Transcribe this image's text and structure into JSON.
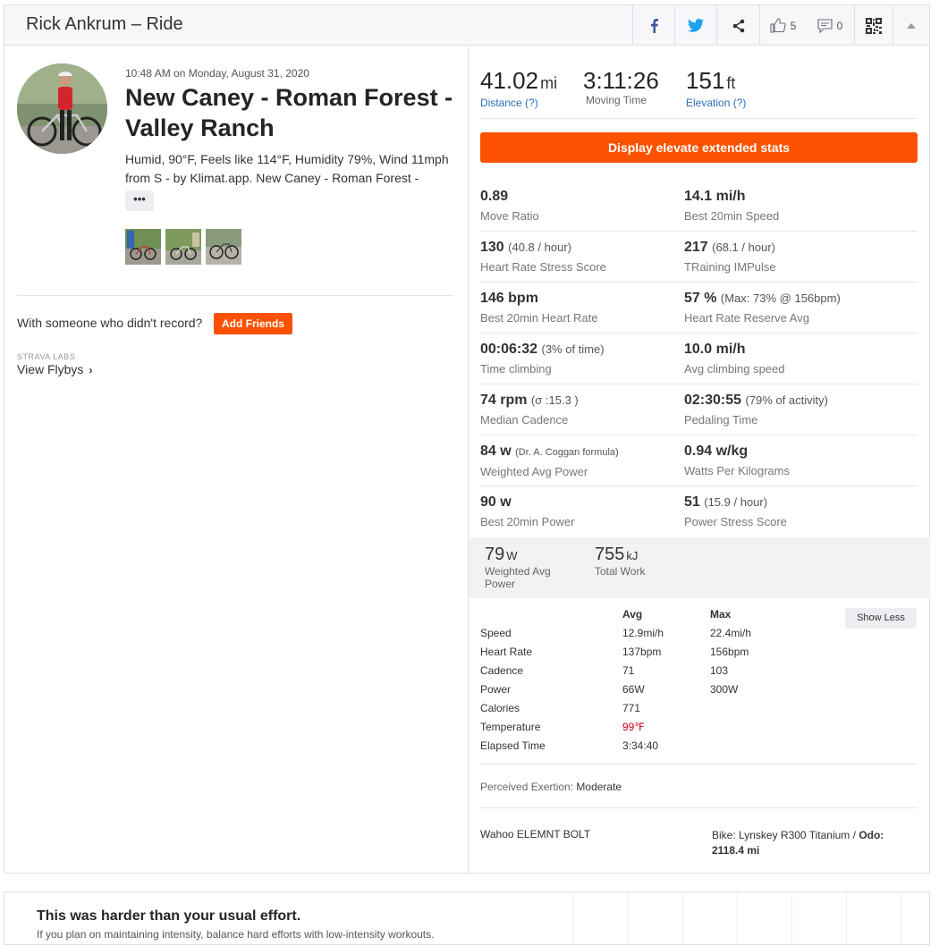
{
  "header": {
    "title": "Rick Ankrum – Ride",
    "kudos_count": "5",
    "comments_count": "0"
  },
  "activity": {
    "timestamp": "10:48 AM on Monday, August 31, 2020",
    "name": "New Caney - Roman Forest - Valley Ranch",
    "description_line1": "Humid, 90°F, Feels like 114°F, Humidity 79%, Wind 11mph",
    "description_line2": "from S - by Klimat.app. New Caney - Roman Forest -",
    "more_label": "•••"
  },
  "social": {
    "with_someone": "With someone who didn't record?",
    "add_friends": "Add Friends",
    "labs": "STRAVA LABS",
    "flybys": "View Flybys",
    "flybys_chevron": "›"
  },
  "primary_stats": {
    "distance": {
      "value": "41.02",
      "unit": "mi",
      "label": "Distance (?)"
    },
    "moving_time": {
      "value": "3:11:26",
      "label": "Moving Time"
    },
    "elevation": {
      "value": "151",
      "unit": "ft",
      "label": "Elevation (?)"
    }
  },
  "elevate_button": "Display elevate extended stats",
  "extended_stats": [
    {
      "value": "0.89",
      "extra": "",
      "label": "Move Ratio"
    },
    {
      "value": "14.1 mi/h",
      "extra": "",
      "label": "Best 20min Speed"
    },
    {
      "value": "130",
      "extra": "(40.8 / hour)",
      "label": "Heart Rate Stress Score"
    },
    {
      "value": "217",
      "extra": "(68.1 / hour)",
      "label": "TRaining IMPulse"
    },
    {
      "value": "146 bpm",
      "extra": "",
      "label": "Best 20min Heart Rate"
    },
    {
      "value": "57 %",
      "extra": "(Max: 73% @ 156bpm)",
      "label": "Heart Rate Reserve Avg"
    },
    {
      "value": "00:06:32",
      "extra": "(3% of time)",
      "label": "Time climbing"
    },
    {
      "value": "10.0 mi/h",
      "extra": "",
      "label": "Avg climbing speed"
    },
    {
      "value": "74 rpm",
      "extra": "(σ :15.3 )",
      "label": "Median Cadence"
    },
    {
      "value": "02:30:55",
      "extra": "(79% of activity)",
      "label": "Pedaling Time"
    },
    {
      "value": "84 w",
      "extra": "(Dr. A. Coggan formula)",
      "label": "Weighted Avg Power"
    },
    {
      "value": "0.94 w/kg",
      "extra": "",
      "label": "Watts Per Kilograms"
    },
    {
      "value": "90 w",
      "extra": "",
      "label": "Best 20min Power"
    },
    {
      "value": "51",
      "extra": "(15.9 / hour)",
      "label": "Power Stress Score"
    }
  ],
  "power_stats": {
    "weighted_avg": {
      "value": "79",
      "unit": "W",
      "label": "Weighted Avg Power"
    },
    "total_work": {
      "value": "755",
      "unit": "kJ",
      "label": "Total Work"
    }
  },
  "more_stats": {
    "headers": [
      "Avg",
      "Max"
    ],
    "show_less": "Show Less",
    "rows": [
      {
        "label": "Speed",
        "avg": "12.9mi/h",
        "max": "22.4mi/h"
      },
      {
        "label": "Heart Rate",
        "avg": "137bpm",
        "max": "156bpm"
      },
      {
        "label": "Cadence",
        "avg": "71",
        "max": "103"
      },
      {
        "label": "Power",
        "avg": "66W",
        "max": "300W"
      },
      {
        "label": "Calories",
        "avg": "771",
        "max": ""
      },
      {
        "label": "Temperature",
        "avg": "99℉",
        "max": ""
      },
      {
        "label": "Elapsed Time",
        "avg": "3:34:40",
        "max": ""
      }
    ],
    "hot_color": "#d0021b"
  },
  "exertion": {
    "label": "Perceived Exertion:",
    "value": "Moderate"
  },
  "device": "Wahoo ELEMNT BOLT",
  "bike": {
    "label": "Bike: Lynskey R300 Titanium /",
    "odo_label": "Odo:",
    "odo_value": "2118.4 mi"
  },
  "effort": {
    "title": "This was harder than your usual effort.",
    "subtitle": "If you plan on maintaining intensity, balance hard efforts with low-intensity workouts."
  },
  "icons": [
    "facebook-icon",
    "twitter-icon",
    "share-icon",
    "thumbs-up-icon",
    "comment-icon",
    "qr-code-icon",
    "collapse-arrow-icon"
  ],
  "colors": {
    "brand": "#fc5200",
    "link": "#2a6ebb"
  }
}
